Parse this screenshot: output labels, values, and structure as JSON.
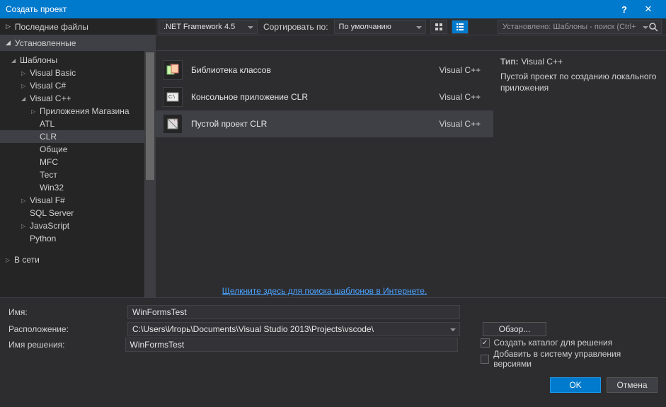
{
  "title": "Создать проект",
  "nav": {
    "recent": "Последние файлы",
    "installed": "Установленные",
    "online": "В сети"
  },
  "toolbar": {
    "framework": ".NET Framework 4.5",
    "sort_label": "Сортировать по:",
    "sort_value": "По умолчанию",
    "search_placeholder": "Установлено: Шаблоны - поиск (Ctrl+"
  },
  "tree": {
    "templates": "Шаблоны",
    "items": [
      "Visual Basic",
      "Visual C#",
      "Visual C++",
      "Visual F#",
      "SQL Server",
      "JavaScript",
      "Python"
    ],
    "sub_vcpp": [
      "Приложения Магазина",
      "ATL",
      "CLR",
      "Общие",
      "MFC",
      "Тест",
      "Win32"
    ]
  },
  "templates": [
    {
      "name": "Библиотека классов",
      "lang": "Visual C++"
    },
    {
      "name": "Консольное приложение CLR",
      "lang": "Visual C++"
    },
    {
      "name": "Пустой проект CLR",
      "lang": "Visual C++"
    }
  ],
  "search_online_link": "Щелкните здесь для поиска шаблонов в Интернете.",
  "details": {
    "type_label": "Тип:",
    "type_value": "Visual C++",
    "description": "Пустой проект по созданию локального приложения"
  },
  "form": {
    "name_label": "Имя:",
    "name_value": "WinFormsTest",
    "location_label": "Расположение:",
    "location_value": "C:\\Users\\Игорь\\Documents\\Visual Studio 2013\\Projects\\vscode\\",
    "solution_label": "Имя решения:",
    "solution_value": "WinFormsTest",
    "browse": "Обзор...",
    "chk_createdir": "Создать каталог для решения",
    "chk_addscm": "Добавить в систему управления версиями"
  },
  "buttons": {
    "ok": "OK",
    "cancel": "Отмена"
  }
}
